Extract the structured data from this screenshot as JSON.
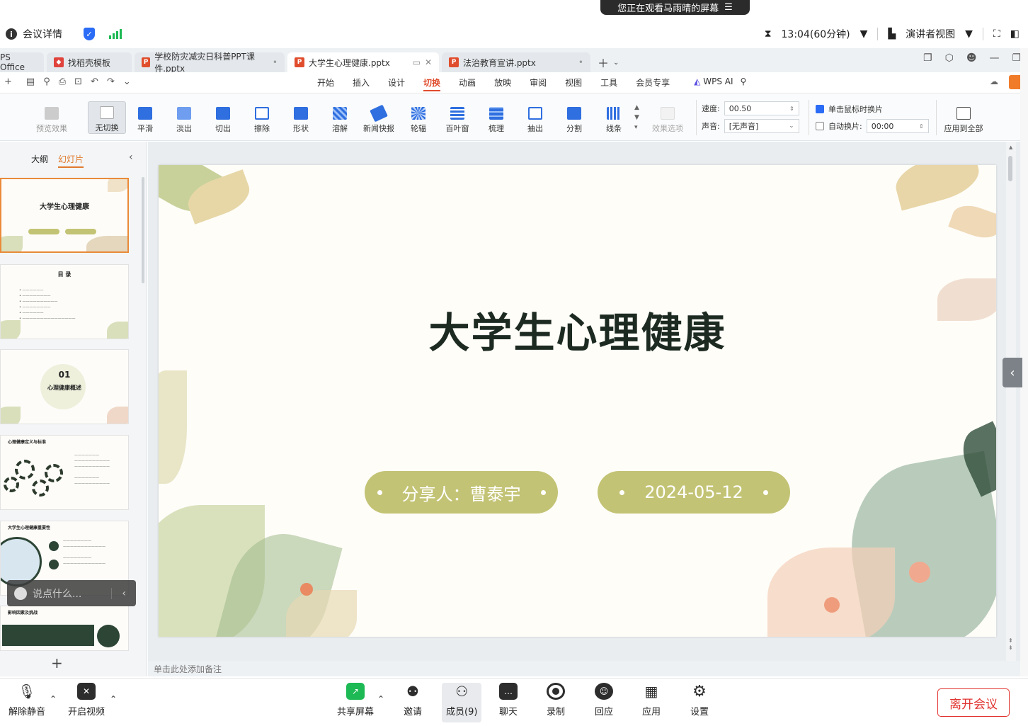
{
  "meeting": {
    "share_banner": "您正在观看马雨晴的屏幕",
    "details": "会议详情",
    "timer": "13:04(60分钟)",
    "view_mode": "演讲者视图"
  },
  "tabs": [
    {
      "label": "PS Office"
    },
    {
      "label": "找稻壳模板"
    },
    {
      "label": "学校防灾减灾日科普PPT课件.pptx"
    },
    {
      "label": "大学生心理健康.pptx",
      "active": true
    },
    {
      "label": "法治教育宣讲.pptx"
    }
  ],
  "menu": [
    "开始",
    "插入",
    "设计",
    "切换",
    "动画",
    "放映",
    "审阅",
    "视图",
    "工具",
    "会员专享"
  ],
  "menu_active": "切换",
  "wps_ai": "WPS AI",
  "ribbon": {
    "preview": "预览效果",
    "transitions": [
      "无切换",
      "平滑",
      "淡出",
      "切出",
      "擦除",
      "形状",
      "溶解",
      "新闻快报",
      "轮辐",
      "百叶窗",
      "梳理",
      "抽出",
      "分割",
      "线条"
    ],
    "effect_options": "效果选项",
    "speed_label": "速度:",
    "speed_value": "00.50",
    "sound_label": "声音:",
    "sound_value": "[无声音]",
    "on_click": "单击鼠标时换片",
    "auto": "自动换片:",
    "auto_value": "00:00",
    "apply_all": "应用到全部"
  },
  "panel": {
    "tab_outline": "大纲",
    "tab_slides": "幻灯片",
    "thumb1_title": "大学生心理健康",
    "thumb2_title": "目 录",
    "thumb3_num": "01",
    "thumb3_title": "心理健康概述",
    "thumb4_title": "心理健康定义与标准",
    "thumb5_title": "大学生心理健康重要性",
    "thumb6_title": "影响因素及挑战",
    "add": "+"
  },
  "chat_placeholder": "说点什么...",
  "slide": {
    "title": "大学生心理健康",
    "presenter": "分享人：曹泰宇",
    "date": "2024-05-12"
  },
  "notes_placeholder": "单击此处添加备注",
  "toolbar": {
    "mute": "解除静音",
    "video": "开启视频",
    "share": "共享屏幕",
    "invite": "邀请",
    "members": "成员(9)",
    "chat": "聊天",
    "record": "录制",
    "react": "回应",
    "apps": "应用",
    "settings": "设置",
    "leave": "离开会议"
  }
}
